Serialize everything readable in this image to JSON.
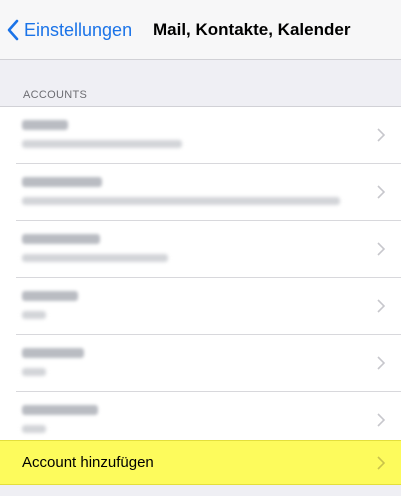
{
  "nav": {
    "back_label": "Einstellungen",
    "title": "Mail, Kontakte, Kalender"
  },
  "section": {
    "header": "ACCOUNTS"
  },
  "accounts": [
    {
      "title": "",
      "subtitle": ""
    },
    {
      "title": "",
      "subtitle": ""
    },
    {
      "title": "",
      "subtitle": ""
    },
    {
      "title": "",
      "subtitle": ""
    },
    {
      "title": "",
      "subtitle": ""
    },
    {
      "title": "",
      "subtitle": ""
    }
  ],
  "add_account": {
    "label": "Account hinzufügen"
  },
  "colors": {
    "accent": "#1a73e8",
    "highlight": "#fdfb5c",
    "background": "#efeff4"
  },
  "icons": {
    "back": "chevron-left-icon",
    "disclosure": "chevron-right-icon"
  }
}
